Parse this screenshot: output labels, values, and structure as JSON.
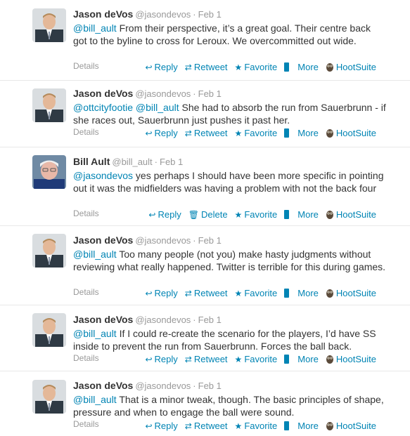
{
  "tweets": [
    {
      "name": "Jason deVos",
      "handle": "@jasondevos",
      "time": "Feb 1",
      "mention": "@bill_ault",
      "body": " From their perspective, it’s a great goal. Their centre back got to the byline to cross for Leroux. We overcommitted out wide.",
      "details": "Details",
      "actions": {
        "reply": "Reply",
        "second": "Retweet",
        "favorite": "Favorite",
        "more": "More",
        "hootsuite": "HootSuite"
      }
    },
    {
      "name": "Jason deVos",
      "handle": "@jasondevos",
      "time": "Feb 1",
      "mention": "@ottcityfootie @bill_ault",
      "body": " She had to absorb the run from Sauerbrunn - if she races out, Sauerbrunn just pushes it past her.",
      "details": "Details",
      "actions": {
        "reply": "Reply",
        "second": "Retweet",
        "favorite": "Favorite",
        "more": "More",
        "hootsuite": "HootSuite"
      }
    },
    {
      "name": "Bill Ault",
      "handle": "@bill_ault",
      "time": "Feb 1",
      "mention": "@jasondevos",
      "body": " yes perhaps I should have been more specific in pointing out it was the midfielders was having a problem with not the back four",
      "details": "Details",
      "actions": {
        "reply": "Reply",
        "second": "Delete",
        "favorite": "Favorite",
        "more": "More",
        "hootsuite": "HootSuite"
      }
    },
    {
      "name": "Jason deVos",
      "handle": "@jasondevos",
      "time": "Feb 1",
      "mention": "@bill_ault",
      "body": " Too many people (not you) make hasty judgments without reviewing what really happened. Twitter is terrible for this during games.",
      "details": "Details",
      "actions": {
        "reply": "Reply",
        "second": "Retweet",
        "favorite": "Favorite",
        "more": "More",
        "hootsuite": "HootSuite"
      }
    },
    {
      "name": "Jason deVos",
      "handle": "@jasondevos",
      "time": "Feb 1",
      "mention": "@bill_ault",
      "body": " If I could re-create the scenario for the players, I’d have SS inside to prevent the run from Sauerbrunn. Forces the ball back.",
      "details": "Details",
      "actions": {
        "reply": "Reply",
        "second": "Retweet",
        "favorite": "Favorite",
        "more": "More",
        "hootsuite": "HootSuite"
      }
    },
    {
      "name": "Jason deVos",
      "handle": "@jasondevos",
      "time": "Feb 1",
      "mention": "@bill_ault",
      "body": " That is a minor tweak, though. The basic principles of shape, pressure and when to engage the ball were sound.",
      "details": "Details",
      "actions": {
        "reply": "Reply",
        "second": "Retweet",
        "favorite": "Favorite",
        "more": "More",
        "hootsuite": "HootSuite"
      }
    }
  ],
  "icons": {
    "reply": "reply-icon",
    "retweet": "retweet-icon",
    "delete": "trash-icon",
    "favorite": "star-icon",
    "more": "more-icon",
    "hootsuite": "hootsuite-owl-icon"
  },
  "colors": {
    "link": "#0084b4",
    "muted": "#999999",
    "text": "#333333"
  }
}
